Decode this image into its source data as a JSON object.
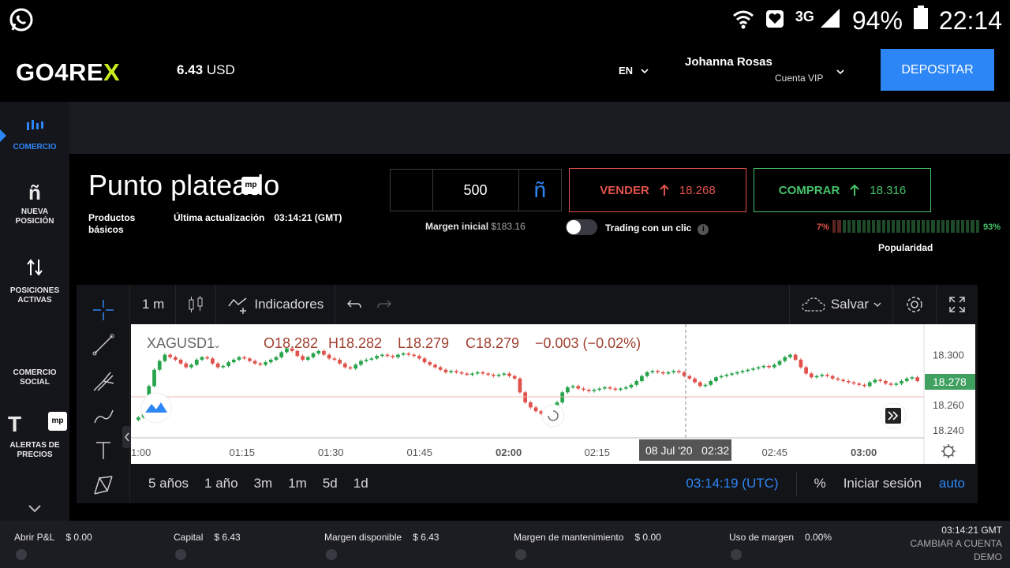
{
  "statusbar": {
    "network": "3G",
    "battery": "94%",
    "time": "22:14",
    "icons": [
      "whatsapp-icon",
      "wifi-icon",
      "heart-app-icon",
      "signal-icon",
      "battery-icon"
    ]
  },
  "header": {
    "logo_main": "GO4RE",
    "logo_accent": "X",
    "balance_amount": "6.43",
    "balance_currency": "USD",
    "language": "EN",
    "user_name": "Johanna Rosas",
    "account_type": "Cuenta VIP",
    "deposit_label": "DEPOSITAR"
  },
  "sidebar": {
    "items": [
      {
        "label": "COMERCIO",
        "icon": "bar-chart-icon"
      },
      {
        "label": "NUEVA POSICIÓN",
        "icon": "enye-icon"
      },
      {
        "label": "POSICIONES ACTIVAS",
        "icon": "swap-arrows-icon"
      },
      {
        "label": "COMERCIO SOCIAL",
        "icon": "social-icon"
      },
      {
        "label": "ALERTAS DE PRECIOS",
        "icon": "alert-icon"
      }
    ]
  },
  "instrument": {
    "name": "Punto plateado",
    "category": "Productos básicos",
    "updated_label": "Última actualización",
    "updated_time": "03:14:21 (GMT)"
  },
  "order": {
    "quantity": "500",
    "increment_glyph": "ñ",
    "initial_margin_label": "Margen inicial",
    "initial_margin_value": "$183.16",
    "sell_label": "VENDER",
    "sell_price": "18.268",
    "buy_label": "COMPRAR",
    "buy_price": "18.316",
    "one_click_label": "Trading con un clic",
    "popularity_low": "7%",
    "popularity_high": "93%",
    "popularity_label": "Popularidad",
    "popularity_fraction": 0.93
  },
  "chart_toolbar": {
    "interval": "1 m",
    "indicators": "Indicadores",
    "save": "Salvar"
  },
  "chart_data": {
    "type": "candlestick",
    "symbol": "XAGUSD1",
    "legend": {
      "open": "O18.282",
      "high": "H18.282",
      "low": "L18.279",
      "close": "C18.279",
      "change": "−0.003 (−0.02%)"
    },
    "x_ticks": [
      "1:00",
      "01:15",
      "01:30",
      "01:45",
      "02:00",
      "02:15",
      "02:45",
      "03:00"
    ],
    "crosshair_label": "08 Jul '20   02:32",
    "y_ticks": [
      "18.300",
      "18.260",
      "18.240"
    ],
    "last_price": "18.278",
    "ylim": [
      18.235,
      18.318
    ],
    "closes": [
      18.25,
      18.262,
      18.275,
      18.288,
      18.295,
      18.3,
      18.298,
      18.296,
      18.293,
      18.29,
      18.292,
      18.296,
      18.298,
      18.297,
      18.293,
      18.29,
      18.291,
      18.294,
      18.296,
      18.298,
      18.297,
      18.295,
      18.293,
      18.292,
      18.294,
      18.296,
      18.298,
      18.302,
      18.305,
      18.303,
      18.299,
      18.296,
      18.298,
      18.301,
      18.303,
      18.3,
      18.297,
      18.296,
      18.293,
      18.29,
      18.289,
      18.292,
      18.295,
      18.296,
      18.297,
      18.299,
      18.3,
      18.299,
      18.298,
      18.3,
      18.301,
      18.3,
      18.299,
      18.297,
      18.294,
      18.292,
      18.29,
      18.288,
      18.286,
      18.287,
      18.286,
      18.285,
      18.284,
      18.285,
      18.286,
      18.285,
      18.284,
      18.283,
      18.284,
      18.285,
      18.283,
      18.281,
      18.27,
      18.262,
      18.258,
      18.255,
      18.253,
      18.254,
      18.256,
      18.262,
      18.27,
      18.274,
      18.275,
      18.273,
      18.272,
      18.271,
      18.272,
      18.273,
      18.274,
      18.273,
      18.272,
      18.273,
      18.274,
      18.276,
      18.279,
      18.283,
      18.286,
      18.287,
      18.286,
      18.285,
      18.286,
      18.287,
      18.286,
      18.283,
      18.281,
      18.278,
      18.275,
      18.276,
      18.279,
      18.282,
      18.283,
      18.284,
      18.285,
      18.286,
      18.287,
      18.288,
      18.289,
      18.29,
      18.291,
      18.29,
      18.292,
      18.295,
      18.298,
      18.3,
      18.296,
      18.29,
      18.285,
      18.282,
      18.283,
      18.284,
      18.283,
      18.281,
      18.28,
      18.279,
      18.278,
      18.277,
      18.276,
      18.275,
      18.278,
      18.28,
      18.279,
      18.277,
      18.276,
      18.277,
      18.279,
      18.281,
      18.282,
      18.279
    ]
  },
  "range_bar": {
    "ranges": [
      "5 años",
      "1 año",
      "3m",
      "1m",
      "5d",
      "1d"
    ],
    "clock": "03:14:19 (UTC)",
    "percent": "%",
    "login": "Iniciar sesión",
    "auto": "auto"
  },
  "bottombar": {
    "items": [
      {
        "label": "Abrir P&L",
        "value": "$ 0.00"
      },
      {
        "label": "Capital",
        "value": "$ 6.43"
      },
      {
        "label": "Margen disponible",
        "value": "$ 6.43"
      },
      {
        "label": "Margen de mantenimiento",
        "value": "$ 0.00"
      },
      {
        "label": "Uso de margen",
        "value": "0.00%"
      }
    ],
    "gmt_time": "03:14:21 GMT",
    "switch_label_1": "CAMBIAR A CUENTA",
    "switch_label_2": "DEMO"
  },
  "colors": {
    "accent": "#2d86f5",
    "sell": "#e0524b",
    "buy": "#47c26a",
    "logo_x": "#c7ec1c",
    "candle_up": "#26a34b",
    "candle_down": "#e0524b"
  }
}
